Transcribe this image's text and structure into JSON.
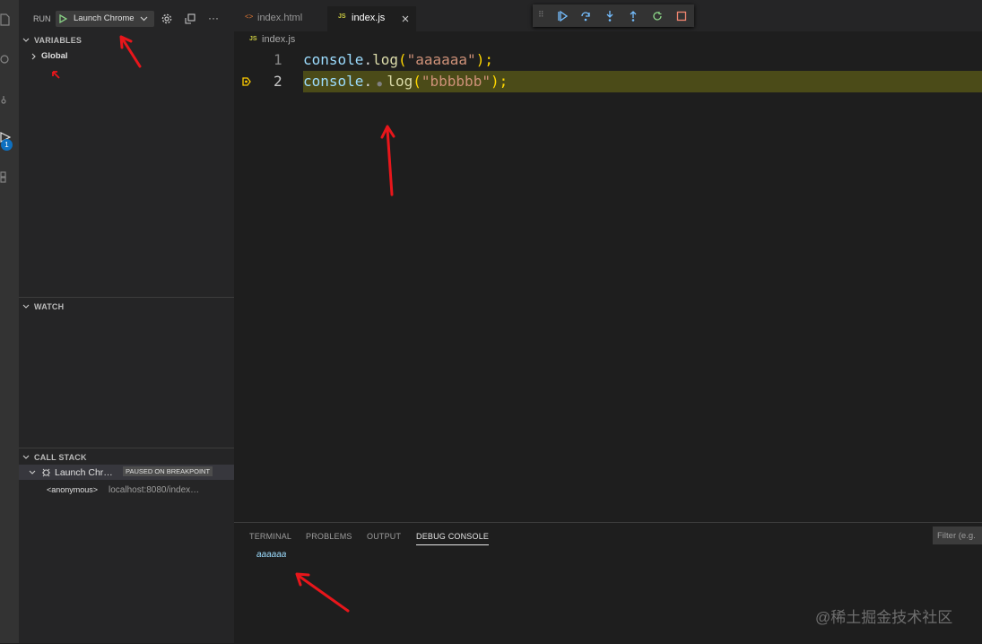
{
  "debug_toolbar": {
    "run_label": "RUN",
    "config_name": "Launch Chrome",
    "more_label": "···"
  },
  "variables": {
    "title": "VARIABLES",
    "scopes": [
      {
        "label": "Global"
      }
    ]
  },
  "watch": {
    "title": "WATCH"
  },
  "call_stack": {
    "title": "CALL STACK",
    "thread": {
      "name": "Launch Chr…",
      "status": "PAUSED ON BREAKPOINT"
    },
    "frames": [
      {
        "name": "<anonymous>",
        "location": "localhost:8080/index…"
      }
    ]
  },
  "activity_bar": {
    "debug_badge": "1"
  },
  "tabs": [
    {
      "label": "index.html",
      "icon": "html-file-icon",
      "icon_text": "<>"
    },
    {
      "label": "index.js",
      "icon": "js-file-icon",
      "icon_text": "JS"
    }
  ],
  "breadcrumb": {
    "icon_text": "JS",
    "file": "index.js"
  },
  "code_lines": [
    {
      "number": "1",
      "obj": "console",
      "dot": ".",
      "method": "log",
      "open": "(",
      "str": "\"aaaaaa\"",
      "close": ");"
    },
    {
      "number": "2",
      "obj": "console",
      "dot": ".",
      "method": "log",
      "open": "(",
      "str": "\"bbbbbb\"",
      "close": ");"
    }
  ],
  "panel": {
    "tabs": [
      "TERMINAL",
      "PROBLEMS",
      "OUTPUT",
      "DEBUG CONSOLE"
    ],
    "active_tab": "DEBUG CONSOLE",
    "filter_placeholder": "Filter (e.g.",
    "console_output": [
      "aaaaaa"
    ]
  },
  "watermark": "@稀土掘金技术社区",
  "colors": {
    "accent": "#0e70c0",
    "debug_line_highlight": "#4b4b18",
    "annotation_arrow": "#e8161b",
    "string": "#ce9178",
    "function": "#dcdcaa",
    "variable": "#9cdcfe"
  }
}
